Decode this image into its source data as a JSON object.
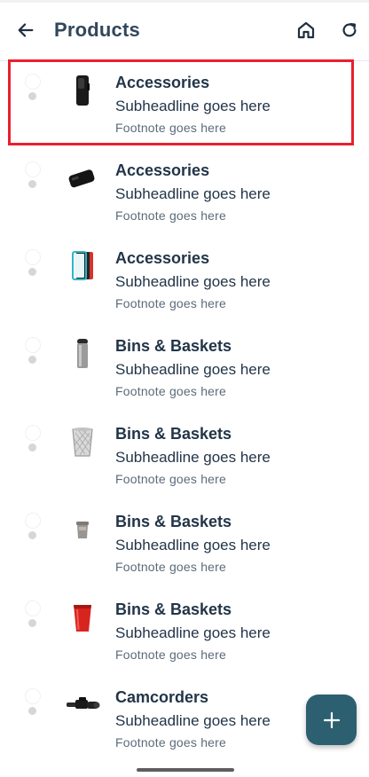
{
  "header": {
    "title": "Products",
    "back_icon": "arrow-left-icon",
    "home_icon": "home-icon",
    "refresh_icon": "refresh-icon"
  },
  "colors": {
    "selection_border": "#e8202e",
    "fab_background": "#2c6071",
    "text_primary": "#223548",
    "text_secondary": "#5b6b7b"
  },
  "items": [
    {
      "headline": "Accessories",
      "subheadline": "Subheadline goes here",
      "footnote": "Footnote goes here",
      "thumbnail": "phone-case-image",
      "selected": true
    },
    {
      "headline": "Accessories",
      "subheadline": "Subheadline goes here",
      "footnote": "Footnote goes here",
      "thumbnail": "power-bank-image",
      "selected": false
    },
    {
      "headline": "Accessories",
      "subheadline": "Subheadline goes here",
      "footnote": "Footnote goes here",
      "thumbnail": "colored-phone-cases-image",
      "selected": false
    },
    {
      "headline": "Bins & Baskets",
      "subheadline": "Subheadline goes here",
      "footnote": "Footnote goes here",
      "thumbnail": "steel-bin-image",
      "selected": false
    },
    {
      "headline": "Bins & Baskets",
      "subheadline": "Subheadline goes here",
      "footnote": "Footnote goes here",
      "thumbnail": "mesh-basket-image",
      "selected": false
    },
    {
      "headline": "Bins & Baskets",
      "subheadline": "Subheadline goes here",
      "footnote": "Footnote goes here",
      "thumbnail": "small-grey-bin-image",
      "selected": false
    },
    {
      "headline": "Bins & Baskets",
      "subheadline": "Subheadline goes here",
      "footnote": "Footnote goes here",
      "thumbnail": "red-bin-image",
      "selected": false
    },
    {
      "headline": "Camcorders",
      "subheadline": "Subheadline goes here",
      "footnote": "Footnote goes here",
      "thumbnail": "camcorder-image",
      "selected": false
    }
  ],
  "fab": {
    "icon": "plus-icon"
  }
}
